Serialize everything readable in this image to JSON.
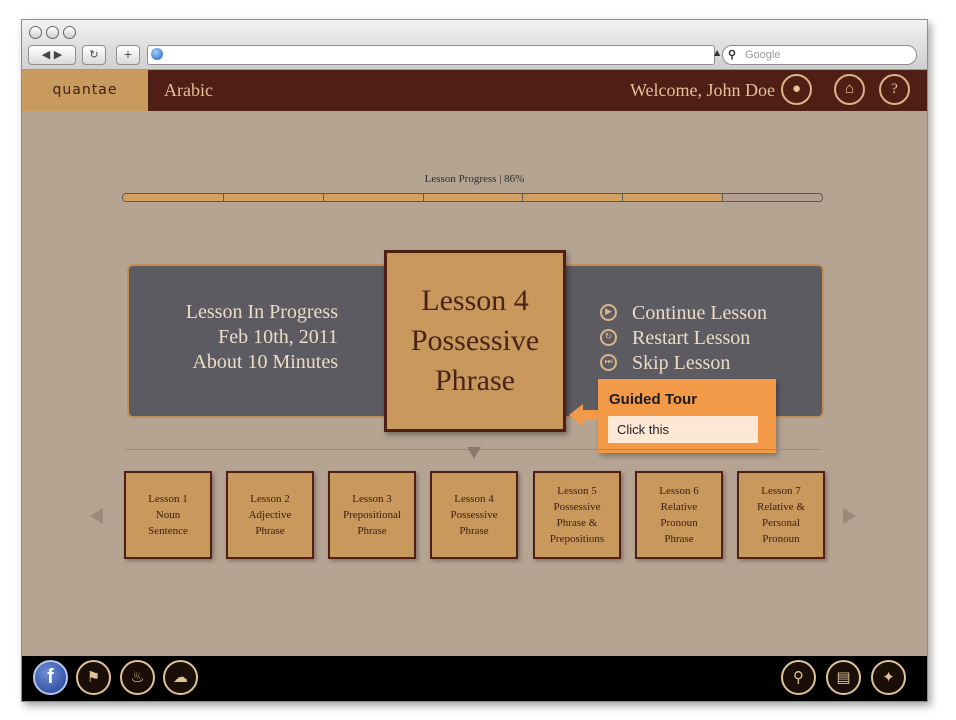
{
  "browser": {
    "search_placeholder": "Google",
    "back_icon": "back-arrow-icon",
    "forward_icon": "forward-arrow-icon",
    "reload_icon": "reload-icon",
    "new_tab_icon": "plus-icon"
  },
  "header": {
    "logo": "quantae",
    "subject": "Arabic",
    "welcome": "Welcome, John Doe",
    "icons": [
      "user-icon",
      "home-icon",
      "help-icon"
    ],
    "help_glyph": "?"
  },
  "progress": {
    "label": "Lesson Progress | 86%",
    "percent": 86,
    "segments": 7,
    "fill_color": "#d4a062"
  },
  "current_lesson": {
    "status_lines": [
      "Lesson In Progress",
      "Feb 10th, 2011",
      "About 10 Minutes"
    ],
    "title_lines": [
      "Lesson 4",
      "Possessive",
      "Phrase"
    ],
    "actions": [
      {
        "label": "Continue Lesson",
        "icon": "play-icon"
      },
      {
        "label": "Restart Lesson",
        "icon": "restart-icon"
      },
      {
        "label": "Skip Lesson",
        "icon": "skip-icon"
      }
    ]
  },
  "tooltip": {
    "title": "Guided Tour",
    "body": "Click this",
    "color": "#f39a49"
  },
  "lessons": [
    {
      "label": "Lesson 1\nNoun\nSentence"
    },
    {
      "label": "Lesson 2\nAdjective\nPhrase"
    },
    {
      "label": "Lesson 3\nPrepositional\nPhrase"
    },
    {
      "label": "Lesson 4\nPossessive\nPhrase"
    },
    {
      "label": "Lesson 5\nPossessive\nPhrase &\nPrepositions"
    },
    {
      "label": "Lesson 6\nRelative\nPronoun\nPhrase"
    },
    {
      "label": "Lesson 7\nRelative &\nPersonal\nPronoun"
    }
  ],
  "footer": {
    "left_icons": [
      "facebook-icon",
      "flag-icon",
      "bell-icon",
      "chat-icon"
    ],
    "right_icons": [
      "search-icon",
      "book-icon",
      "compass-icon"
    ],
    "facebook_glyph": "f"
  },
  "colors": {
    "header_bg": "#4f1e14",
    "page_bg": "#b6a493",
    "panel_bg": "#5d5b62",
    "card_bg": "#c9985d"
  }
}
